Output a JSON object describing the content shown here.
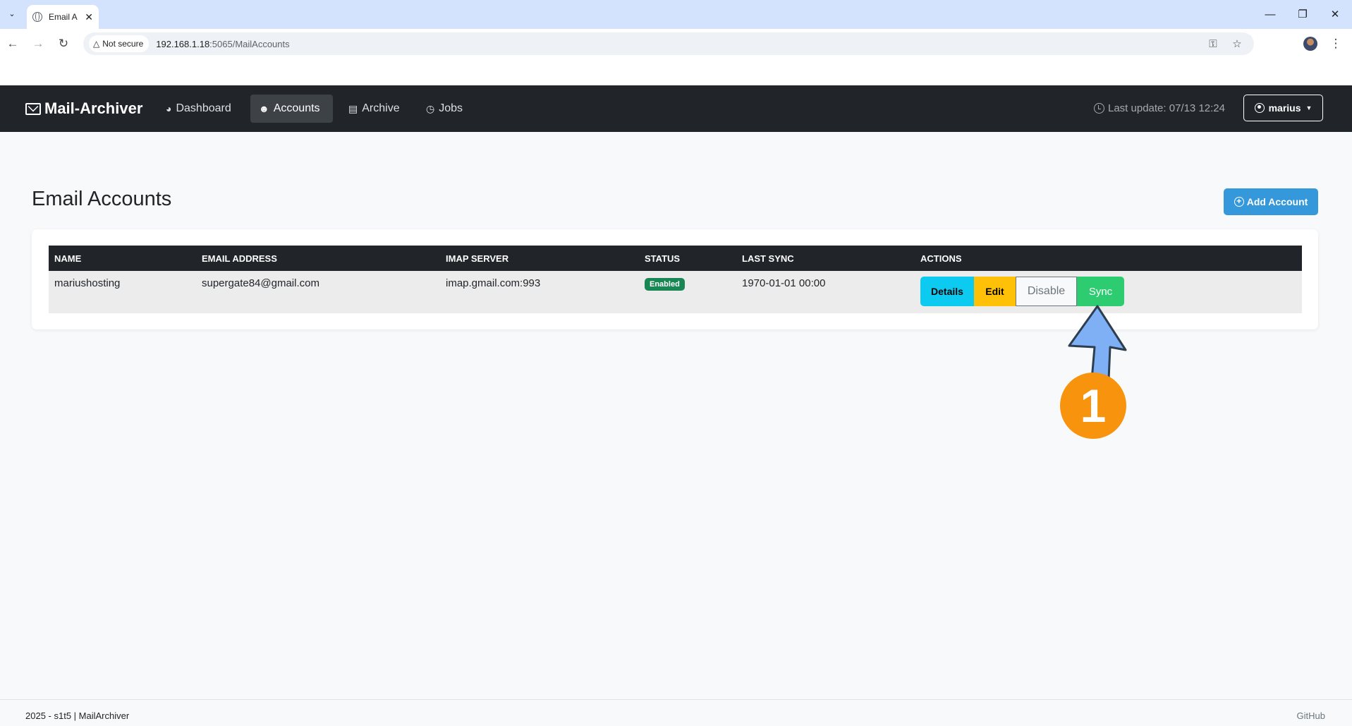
{
  "browser": {
    "tab_title": "Email A",
    "security_label": "Not secure",
    "url_host": "192.168.1.18",
    "url_path": ":5065/MailAccounts"
  },
  "app": {
    "brand": "Mail-Archiver",
    "nav": [
      {
        "label": "Dashboard",
        "icon": "gauge-icon"
      },
      {
        "label": "Accounts",
        "icon": "person-icon",
        "active": true
      },
      {
        "label": "Archive",
        "icon": "archive-box-icon"
      },
      {
        "label": "Jobs",
        "icon": "clock-icon"
      }
    ],
    "last_update": "Last update: 07/13 12:24",
    "user": "marius"
  },
  "main": {
    "title": "Email Accounts",
    "add_button": "Add Account",
    "table": {
      "headers": [
        "NAME",
        "EMAIL ADDRESS",
        "IMAP SERVER",
        "STATUS",
        "LAST SYNC",
        "ACTIONS"
      ],
      "rows": [
        {
          "name": "mariushosting",
          "email": "supergate84@gmail.com",
          "imap": "imap.gmail.com:993",
          "status": "Enabled",
          "last_sync": "1970-01-01 00:00",
          "actions": {
            "details": "Details",
            "edit": "Edit",
            "disable": "Disable",
            "sync": "Sync"
          }
        }
      ]
    }
  },
  "annotation": {
    "step": "1",
    "color": "#f7930c",
    "arrow_color": "#7fb0f5"
  },
  "footer": {
    "left": "2025 - s1t5 | MailArchiver",
    "right": "GitHub"
  },
  "colors": {
    "navbar": "#212529",
    "primary": "#3498db",
    "success": "#198754",
    "info": "#0dcaf0",
    "warning": "#ffc107",
    "sync": "#2ecc71"
  }
}
